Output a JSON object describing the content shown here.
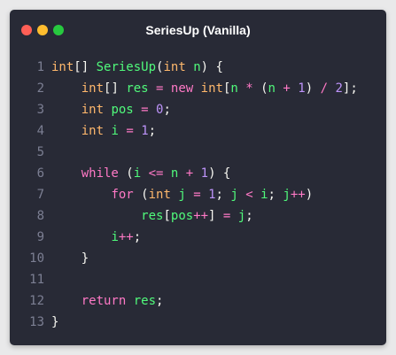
{
  "window": {
    "title": "SeriesUp (Vanilla)",
    "controls": {
      "close_color": "#ff5f56",
      "minimize_color": "#ffbd2e",
      "maximize_color": "#27c93f"
    }
  },
  "code": {
    "lines": [
      {
        "number": "1",
        "tokens": [
          {
            "t": "int",
            "c": "type"
          },
          {
            "t": "[] ",
            "c": "punc"
          },
          {
            "t": "SeriesUp",
            "c": "fn"
          },
          {
            "t": "(",
            "c": "punc"
          },
          {
            "t": "int",
            "c": "type"
          },
          {
            "t": " ",
            "c": "punc"
          },
          {
            "t": "n",
            "c": "var"
          },
          {
            "t": ") {",
            "c": "punc"
          }
        ]
      },
      {
        "number": "2",
        "tokens": [
          {
            "t": "    ",
            "c": "punc"
          },
          {
            "t": "int",
            "c": "type"
          },
          {
            "t": "[] ",
            "c": "punc"
          },
          {
            "t": "res",
            "c": "var"
          },
          {
            "t": " = ",
            "c": "op"
          },
          {
            "t": "new",
            "c": "kw"
          },
          {
            "t": " ",
            "c": "punc"
          },
          {
            "t": "int",
            "c": "type"
          },
          {
            "t": "[",
            "c": "punc"
          },
          {
            "t": "n",
            "c": "var"
          },
          {
            "t": " * ",
            "c": "op"
          },
          {
            "t": "(",
            "c": "punc"
          },
          {
            "t": "n",
            "c": "var"
          },
          {
            "t": " + ",
            "c": "op"
          },
          {
            "t": "1",
            "c": "num"
          },
          {
            "t": ") ",
            "c": "punc"
          },
          {
            "t": "/",
            "c": "op"
          },
          {
            "t": " ",
            "c": "punc"
          },
          {
            "t": "2",
            "c": "num"
          },
          {
            "t": "];",
            "c": "punc"
          }
        ]
      },
      {
        "number": "3",
        "tokens": [
          {
            "t": "    ",
            "c": "punc"
          },
          {
            "t": "int",
            "c": "type"
          },
          {
            "t": " ",
            "c": "punc"
          },
          {
            "t": "pos",
            "c": "var"
          },
          {
            "t": " = ",
            "c": "op"
          },
          {
            "t": "0",
            "c": "num"
          },
          {
            "t": ";",
            "c": "punc"
          }
        ]
      },
      {
        "number": "4",
        "tokens": [
          {
            "t": "    ",
            "c": "punc"
          },
          {
            "t": "int",
            "c": "type"
          },
          {
            "t": " ",
            "c": "punc"
          },
          {
            "t": "i",
            "c": "var"
          },
          {
            "t": " = ",
            "c": "op"
          },
          {
            "t": "1",
            "c": "num"
          },
          {
            "t": ";",
            "c": "punc"
          }
        ]
      },
      {
        "number": "5",
        "tokens": []
      },
      {
        "number": "6",
        "tokens": [
          {
            "t": "    ",
            "c": "punc"
          },
          {
            "t": "while",
            "c": "kw"
          },
          {
            "t": " (",
            "c": "punc"
          },
          {
            "t": "i",
            "c": "var"
          },
          {
            "t": " <= ",
            "c": "op"
          },
          {
            "t": "n",
            "c": "var"
          },
          {
            "t": " + ",
            "c": "op"
          },
          {
            "t": "1",
            "c": "num"
          },
          {
            "t": ") {",
            "c": "punc"
          }
        ]
      },
      {
        "number": "7",
        "tokens": [
          {
            "t": "        ",
            "c": "punc"
          },
          {
            "t": "for",
            "c": "kw"
          },
          {
            "t": " (",
            "c": "punc"
          },
          {
            "t": "int",
            "c": "type"
          },
          {
            "t": " ",
            "c": "punc"
          },
          {
            "t": "j",
            "c": "var"
          },
          {
            "t": " = ",
            "c": "op"
          },
          {
            "t": "1",
            "c": "num"
          },
          {
            "t": "; ",
            "c": "punc"
          },
          {
            "t": "j",
            "c": "var"
          },
          {
            "t": " < ",
            "c": "op"
          },
          {
            "t": "i",
            "c": "var"
          },
          {
            "t": "; ",
            "c": "punc"
          },
          {
            "t": "j",
            "c": "var"
          },
          {
            "t": "++",
            "c": "op"
          },
          {
            "t": ")",
            "c": "punc"
          }
        ]
      },
      {
        "number": "8",
        "tokens": [
          {
            "t": "            ",
            "c": "punc"
          },
          {
            "t": "res",
            "c": "var"
          },
          {
            "t": "[",
            "c": "punc"
          },
          {
            "t": "pos",
            "c": "var"
          },
          {
            "t": "++",
            "c": "op"
          },
          {
            "t": "] ",
            "c": "punc"
          },
          {
            "t": "=",
            "c": "op"
          },
          {
            "t": " ",
            "c": "punc"
          },
          {
            "t": "j",
            "c": "var"
          },
          {
            "t": ";",
            "c": "punc"
          }
        ]
      },
      {
        "number": "9",
        "tokens": [
          {
            "t": "        ",
            "c": "punc"
          },
          {
            "t": "i",
            "c": "var"
          },
          {
            "t": "++",
            "c": "op"
          },
          {
            "t": ";",
            "c": "punc"
          }
        ]
      },
      {
        "number": "10",
        "tokens": [
          {
            "t": "    }",
            "c": "punc"
          }
        ]
      },
      {
        "number": "11",
        "tokens": []
      },
      {
        "number": "12",
        "tokens": [
          {
            "t": "    ",
            "c": "punc"
          },
          {
            "t": "return",
            "c": "kw"
          },
          {
            "t": " ",
            "c": "punc"
          },
          {
            "t": "res",
            "c": "var"
          },
          {
            "t": ";",
            "c": "punc"
          }
        ]
      },
      {
        "number": "13",
        "tokens": [
          {
            "t": "}",
            "c": "punc"
          }
        ]
      }
    ]
  }
}
